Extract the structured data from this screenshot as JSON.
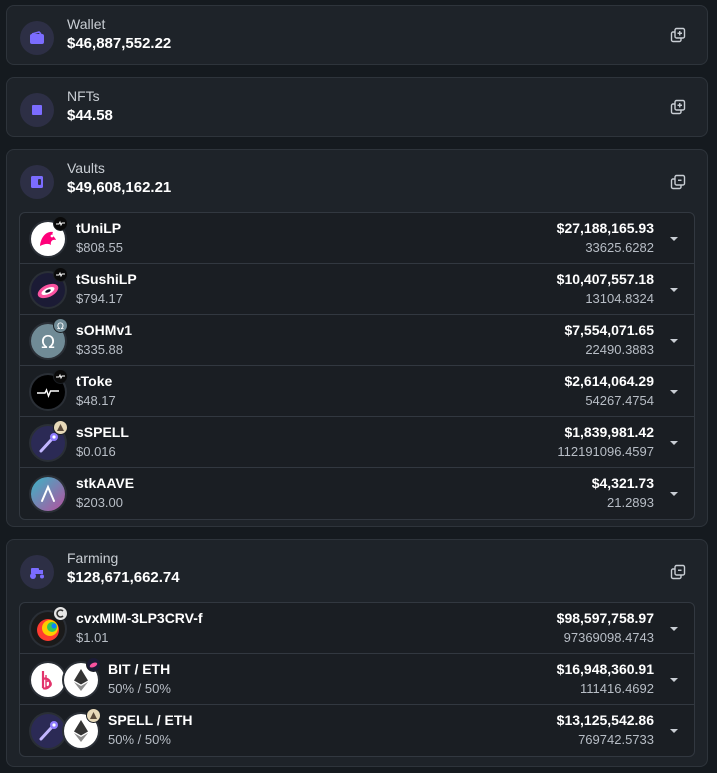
{
  "colors": {
    "background": "#151a1f",
    "card": "#1e2329",
    "accent": "#7b6cff"
  },
  "wallet": {
    "label": "Wallet",
    "value": "$46,887,552.22",
    "icon": "wallet-icon"
  },
  "nfts": {
    "label": "NFTs",
    "value": "$44.58",
    "icon": "nft-square-icon"
  },
  "vaults": {
    "label": "Vaults",
    "value": "$49,608,162.21",
    "icon": "vault-icon",
    "items": [
      {
        "name": "tUniLP",
        "price": "$808.55",
        "value": "$27,188,165.93",
        "amount": "33625.6282"
      },
      {
        "name": "tSushiLP",
        "price": "$794.17",
        "value": "$10,407,557.18",
        "amount": "13104.8324"
      },
      {
        "name": "sOHMv1",
        "price": "$335.88",
        "value": "$7,554,071.65",
        "amount": "22490.3883"
      },
      {
        "name": "tToke",
        "price": "$48.17",
        "value": "$2,614,064.29",
        "amount": "54267.4754"
      },
      {
        "name": "sSPELL",
        "price": "$0.016",
        "value": "$1,839,981.42",
        "amount": "112191096.4597"
      },
      {
        "name": "stkAAVE",
        "price": "$203.00",
        "value": "$4,321.73",
        "amount": "21.2893"
      }
    ]
  },
  "farming": {
    "label": "Farming",
    "value": "$128,671,662.74",
    "icon": "tractor-icon",
    "items": [
      {
        "name": "cvxMIM-3LP3CRV-f",
        "price": "$1.01",
        "value": "$98,597,758.97",
        "amount": "97369098.4743"
      },
      {
        "name": "BIT / ETH",
        "price": "50% / 50%",
        "value": "$16,948,360.91",
        "amount": "111416.4692"
      },
      {
        "name": "SPELL / ETH",
        "price": "50% / 50%",
        "value": "$13,125,542.86",
        "amount": "769742.5733"
      }
    ]
  }
}
